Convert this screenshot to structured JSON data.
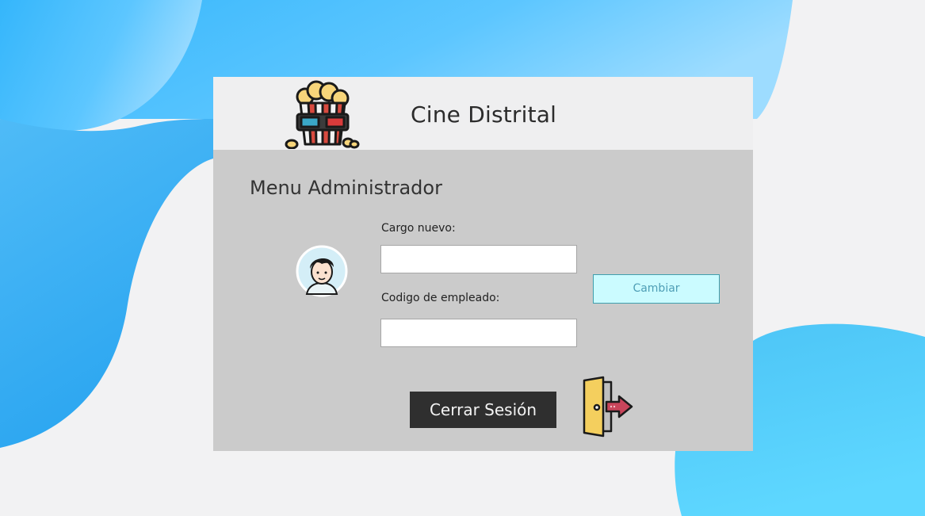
{
  "header": {
    "app_title": "Cine Distrital",
    "logo_icon": "popcorn-3d-glasses-icon"
  },
  "main": {
    "section_title": "Menu Administrador",
    "avatar_icon": "user-avatar-icon",
    "cargo_label": "Cargo nuevo:",
    "cargo_value": "",
    "cargo_placeholder": "",
    "codigo_label": "Codigo de empleado:",
    "codigo_value": "",
    "codigo_placeholder": "",
    "cambiar_label": "Cambiar",
    "cerrar_label": "Cerrar Sesión",
    "exit_icon": "exit-door-icon"
  },
  "colors": {
    "page_background": "#f2f2f3",
    "blob_blue": "#4fc3f7",
    "card_body": "#cbcbcb",
    "card_header": "#efeff0",
    "cambiar_bg": "#cbfbff",
    "cerrar_bg": "#2f2f2f"
  }
}
